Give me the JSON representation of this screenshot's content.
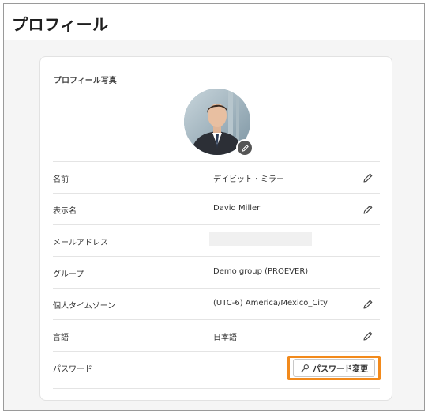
{
  "header": {
    "title": "プロフィール"
  },
  "profile_photo": {
    "label": "プロフィール写真",
    "edit_icon": "pencil-icon"
  },
  "fields": [
    {
      "label": "名前",
      "value": "デイビット・ミラー",
      "editable": true
    },
    {
      "label": "表示名",
      "value": "David Miller",
      "editable": true
    },
    {
      "label": "メールアドレス",
      "value": "",
      "editable": false
    },
    {
      "label": "グループ",
      "value": "Demo group (PROEVER)",
      "editable": false
    },
    {
      "label": "個人タイムゾーン",
      "value": "(UTC-6) America/Mexico_City",
      "editable": true
    },
    {
      "label": "言語",
      "value": "日本語",
      "editable": true
    }
  ],
  "password": {
    "label": "パスワード",
    "button_label": "パスワード変更",
    "button_icon": "key-icon",
    "highlight_color": "#f28a1c"
  },
  "colors": {
    "page_background": "#f5f5f5",
    "card_background": "#ffffff",
    "highlight": "#f28a1c"
  }
}
